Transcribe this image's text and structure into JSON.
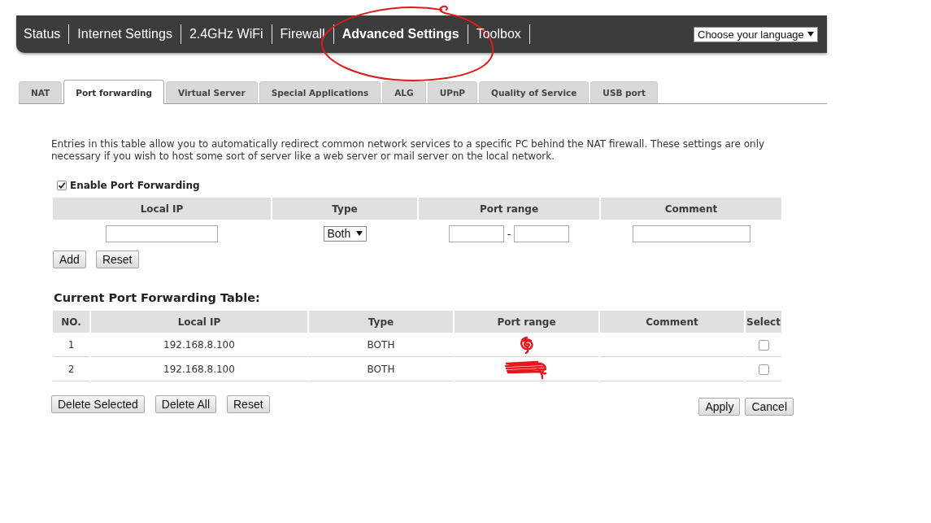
{
  "nav": {
    "items": [
      {
        "label": "Status",
        "selected": false,
        "circled": false
      },
      {
        "label": "Internet Settings",
        "selected": false,
        "circled": false
      },
      {
        "label": "2.4GHz WiFi",
        "selected": false,
        "circled": false
      },
      {
        "label": "Firewall",
        "selected": false,
        "circled": false
      },
      {
        "label": "Advanced Settings",
        "selected": true,
        "circled": true
      },
      {
        "label": "Toolbox",
        "selected": false,
        "circled": false
      }
    ],
    "language_select": {
      "value": "Choose your language"
    }
  },
  "tabs": [
    {
      "label": "NAT",
      "selected": false
    },
    {
      "label": "Port forwarding",
      "selected": true
    },
    {
      "label": "Virtual Server",
      "selected": false
    },
    {
      "label": "Special Applications",
      "selected": false
    },
    {
      "label": "ALG",
      "selected": false
    },
    {
      "label": "UPnP",
      "selected": false
    },
    {
      "label": "Quality of Service",
      "selected": false
    },
    {
      "label": "USB port",
      "selected": false
    }
  ],
  "description": "Entries in this table allow you to automatically redirect common network services to a specific PC behind the NAT firewall. These settings are only necessary if you wish to host some sort of server like a web server or mail server on the local network.",
  "enable_port_forwarding": {
    "label": "Enable Port Forwarding",
    "checked": true
  },
  "entry_form": {
    "columns": [
      "Local IP",
      "Type",
      "Port range",
      "Comment"
    ],
    "type_select": {
      "value": "Both"
    },
    "range_separator": "-",
    "buttons": [
      "Add",
      "Reset"
    ]
  },
  "current_table": {
    "title": "Current Port Forwarding Table:",
    "columns": [
      "NO.",
      "Local IP",
      "Type",
      "Port range",
      "Comment",
      "Select"
    ],
    "rows": [
      {
        "no": "1",
        "local_ip": "192.168.8.100",
        "type": "BOTH",
        "port_range_redacted": true,
        "selected": false
      },
      {
        "no": "2",
        "local_ip": "192.168.8.100",
        "type": "BOTH",
        "port_range_redacted": true,
        "selected": false
      }
    ]
  },
  "table_buttons": [
    "Delete Selected",
    "Delete All",
    "Reset"
  ],
  "form_buttons": [
    "Apply",
    "Cancel"
  ]
}
